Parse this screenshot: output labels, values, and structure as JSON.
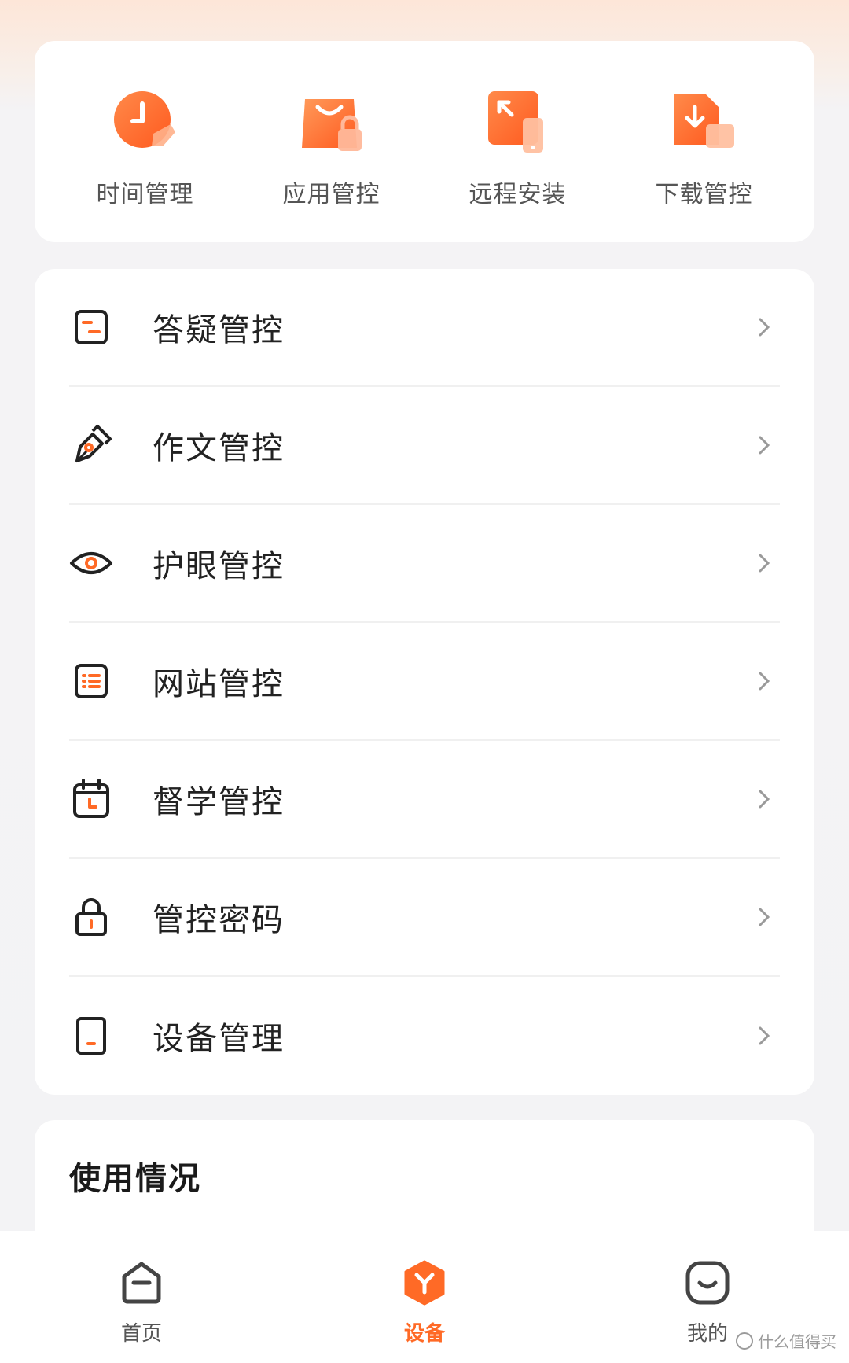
{
  "quick_actions": [
    {
      "label": "时间管理",
      "icon": "clock-icon"
    },
    {
      "label": "应用管控",
      "icon": "shopping-bag-lock-icon"
    },
    {
      "label": "远程安装",
      "icon": "remote-install-icon"
    },
    {
      "label": "下载管控",
      "icon": "download-control-icon"
    }
  ],
  "menu": [
    {
      "label": "答疑管控",
      "icon": "qa-icon"
    },
    {
      "label": "作文管控",
      "icon": "pen-nib-icon"
    },
    {
      "label": "护眼管控",
      "icon": "eye-icon"
    },
    {
      "label": "网站管控",
      "icon": "website-list-icon"
    },
    {
      "label": "督学管控",
      "icon": "calendar-clock-icon"
    },
    {
      "label": "管控密码",
      "icon": "lock-icon"
    },
    {
      "label": "设备管理",
      "icon": "tablet-icon"
    }
  ],
  "usage": {
    "title": "使用情况"
  },
  "tabs": [
    {
      "label": "首页",
      "icon": "home-icon",
      "active": false
    },
    {
      "label": "设备",
      "icon": "device-hex-icon",
      "active": true
    },
    {
      "label": "我的",
      "icon": "profile-face-icon",
      "active": false
    }
  ],
  "watermark": "什么值得买",
  "colors": {
    "accent": "#ff6a26",
    "text_dark": "#222222",
    "text_muted": "#555555"
  }
}
